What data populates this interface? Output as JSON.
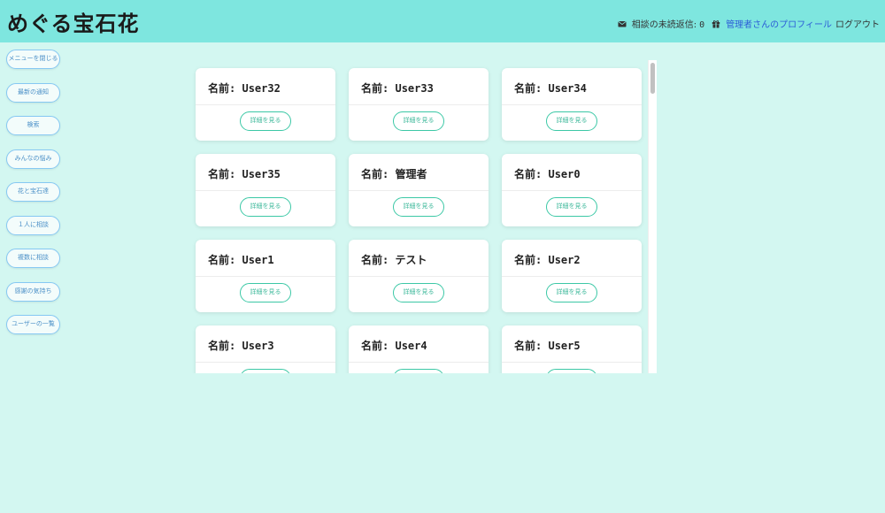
{
  "header": {
    "title": "めぐる宝石花",
    "unread_label": "相談の未読返信:",
    "unread_count": "0",
    "profile_link": "管理者さんのプロフィール",
    "logout": "ログアウト",
    "mail_icon": "envelope-icon",
    "gift_icon": "gift-icon"
  },
  "sidebar": {
    "items": [
      {
        "label": "メニューを閉じる"
      },
      {
        "label": "最新の通知"
      },
      {
        "label": "検索"
      },
      {
        "label": "みんなの悩み"
      },
      {
        "label": "花と宝石達"
      },
      {
        "label": "１人に相談"
      },
      {
        "label": "複数に相談"
      },
      {
        "label": "感謝の気持ち"
      },
      {
        "label": "ユーザーの一覧"
      }
    ]
  },
  "users": {
    "name_prefix": "名前:",
    "detail_label": "詳細を見る",
    "cards": [
      {
        "name": "User32"
      },
      {
        "name": "User33"
      },
      {
        "name": "User34"
      },
      {
        "name": "User35"
      },
      {
        "name": "管理者"
      },
      {
        "name": "User0"
      },
      {
        "name": "User1"
      },
      {
        "name": "テスト"
      },
      {
        "name": "User2"
      },
      {
        "name": "User3"
      },
      {
        "name": "User4"
      },
      {
        "name": "User5"
      }
    ]
  }
}
